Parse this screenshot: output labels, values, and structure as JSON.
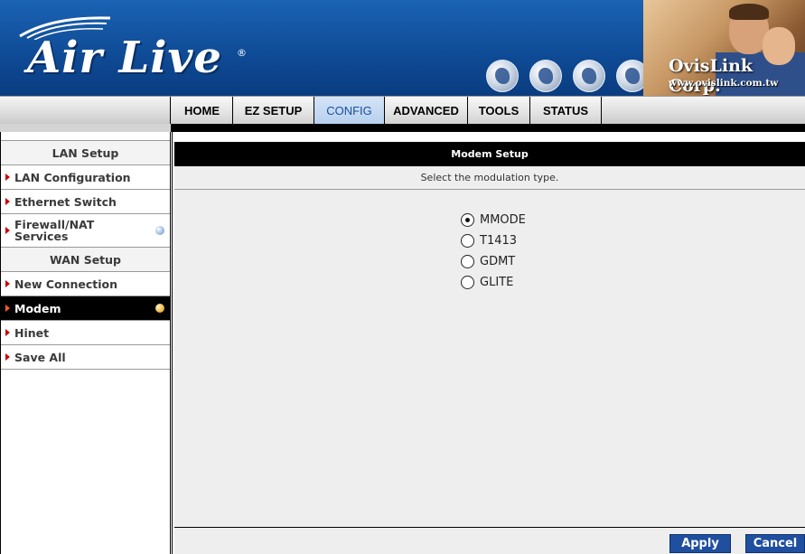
{
  "banner": {
    "logo_text": "Air Live",
    "logo_reg": "®",
    "corp_name": "OvisLink Corp.",
    "corp_url": "www.ovislink.com.tw"
  },
  "nav": {
    "tabs": [
      {
        "label": "HOME",
        "active": false
      },
      {
        "label": "EZ SETUP",
        "active": false
      },
      {
        "label": "CONFIG",
        "active": true
      },
      {
        "label": "ADVANCED",
        "active": false
      },
      {
        "label": "TOOLS",
        "active": false
      },
      {
        "label": "STATUS",
        "active": false
      }
    ]
  },
  "sidebar": {
    "items": [
      {
        "label": "LAN Setup",
        "type": "header"
      },
      {
        "label": "LAN Configuration",
        "type": "link"
      },
      {
        "label": "Ethernet Switch",
        "type": "link"
      },
      {
        "label": "Firewall/NAT Services",
        "type": "link"
      },
      {
        "label": "WAN Setup",
        "type": "header"
      },
      {
        "label": "New Connection",
        "type": "link"
      },
      {
        "label": "Modem",
        "type": "link",
        "selected": true
      },
      {
        "label": "Hinet",
        "type": "link"
      },
      {
        "label": "Save All",
        "type": "link"
      }
    ]
  },
  "main": {
    "title": "Modem Setup",
    "subtitle": "Select the modulation type.",
    "options": [
      {
        "label": "MMODE",
        "checked": true
      },
      {
        "label": "T1413",
        "checked": false
      },
      {
        "label": "GDMT",
        "checked": false
      },
      {
        "label": "GLITE",
        "checked": false
      }
    ],
    "apply_label": "Apply",
    "cancel_label": "Cancel"
  },
  "colors": {
    "banner_blue": "#0f4c97",
    "button_blue": "#1f4f9e",
    "active_tab": "#b7d0ee",
    "arrow_red": "#cc0000"
  },
  "icons": [
    "airlive-logo",
    "globe-icon",
    "globe-icon",
    "globe-icon",
    "globe-icon",
    "arrow-icon",
    "status-dot-icon"
  ]
}
